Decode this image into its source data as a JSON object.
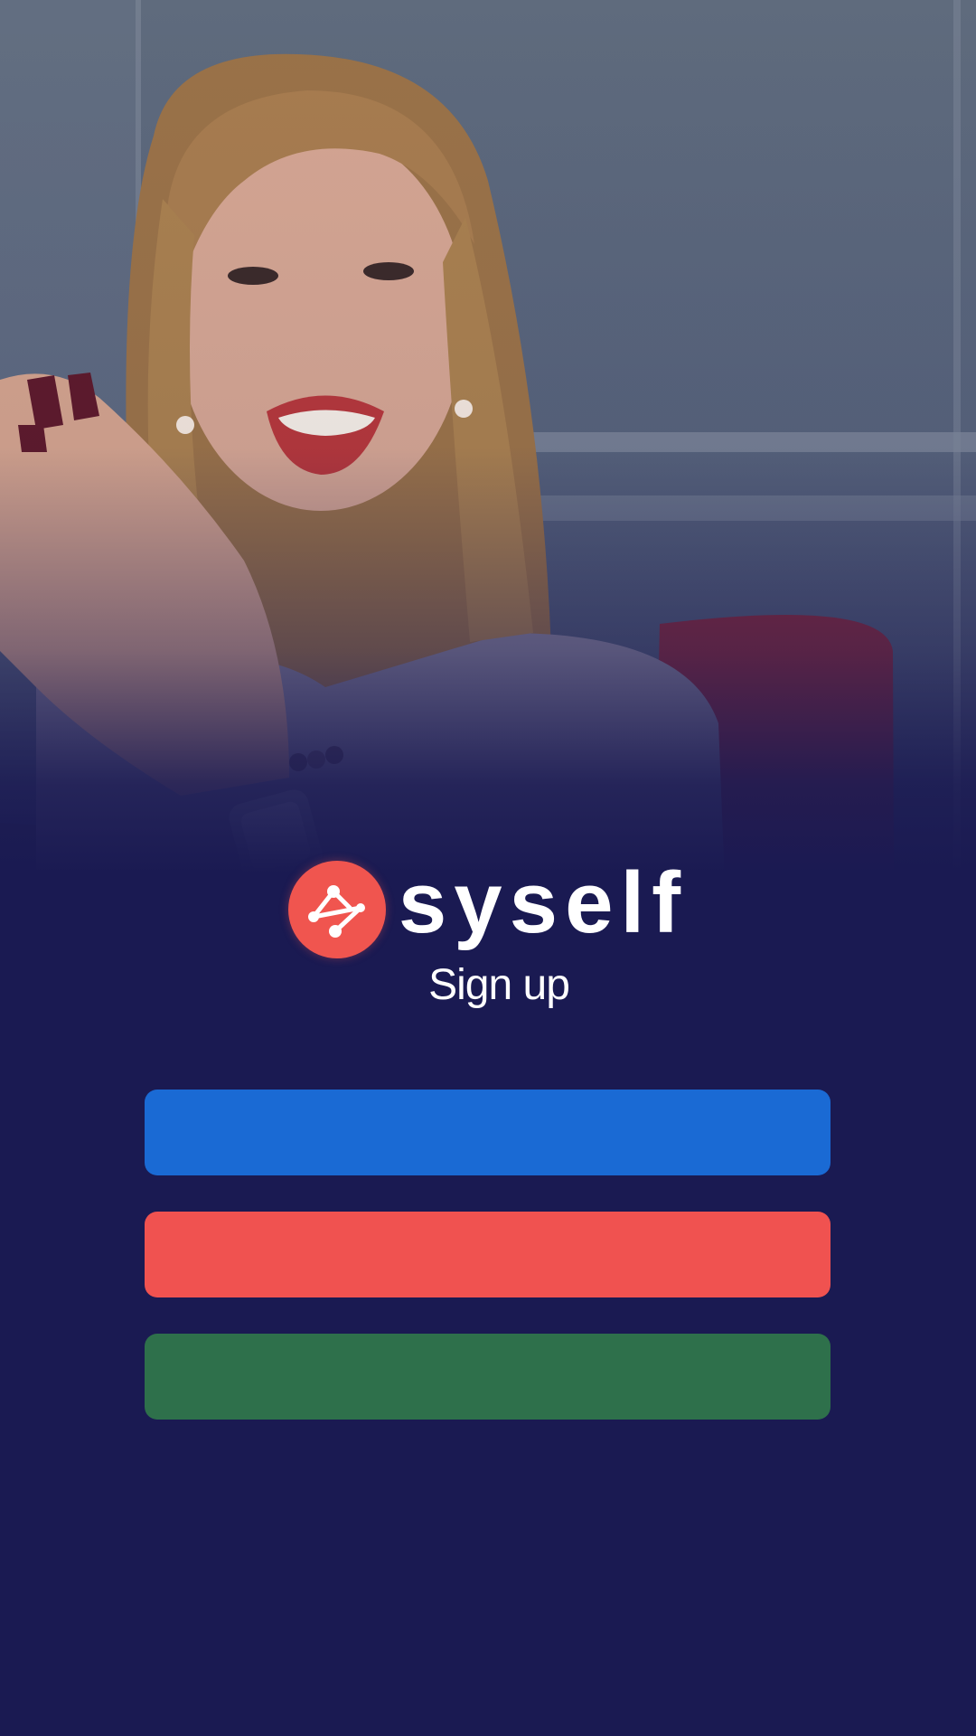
{
  "app": {
    "brand_name": "syself",
    "logo_icon": "network-nodes-icon"
  },
  "screen": {
    "title": "Sign up",
    "background": "photo-woman-smiling-clapping"
  },
  "buttons": [
    {
      "label": "",
      "color": "#1a6ad4"
    },
    {
      "label": "",
      "color": "#f05250"
    },
    {
      "label": "",
      "color": "#2e704b"
    }
  ],
  "colors": {
    "background": "#1a1a52",
    "logo": "#f0554f",
    "text": "#ffffff"
  }
}
